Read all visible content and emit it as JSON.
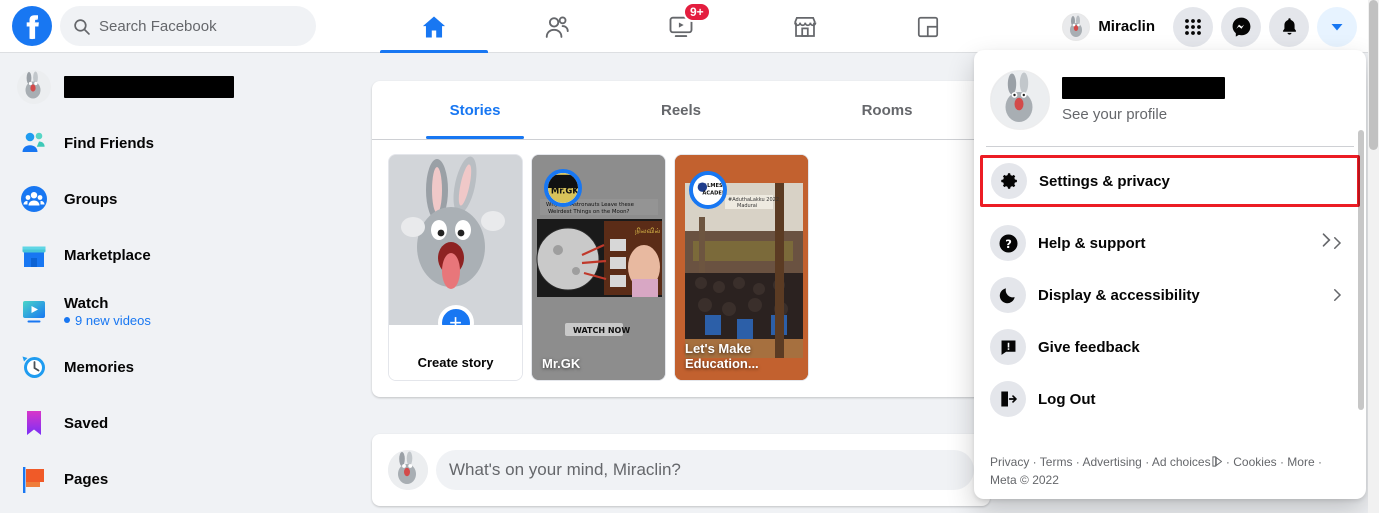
{
  "brand": {
    "accent": "#1877f2",
    "bg": "#f0f2f5",
    "badge_red": "#e41e3f",
    "highlight_red": "#ec1c24"
  },
  "topbar": {
    "logo": "facebook-logo",
    "search": {
      "placeholder": "Search Facebook",
      "value": "",
      "icon": "search-icon"
    },
    "nav": [
      {
        "name": "home",
        "icon": "home-icon",
        "selected": true,
        "badge": ""
      },
      {
        "name": "friends",
        "icon": "friends-icon",
        "selected": false,
        "badge": ""
      },
      {
        "name": "watch",
        "icon": "watch-icon",
        "selected": false,
        "badge": "9+"
      },
      {
        "name": "marketplace",
        "icon": "marketplace-icon",
        "selected": false,
        "badge": ""
      },
      {
        "name": "groups",
        "icon": "gaming-icon",
        "selected": false,
        "badge": ""
      }
    ],
    "profile_name": "Miraclin",
    "actions": [
      {
        "name": "menu",
        "icon": "grid-menu-icon"
      },
      {
        "name": "messenger",
        "icon": "messenger-icon"
      },
      {
        "name": "notifications",
        "icon": "bell-icon"
      },
      {
        "name": "account",
        "icon": "chevron-down-icon",
        "active": true
      }
    ]
  },
  "sidebar": {
    "items": [
      {
        "label": "",
        "redacted": true,
        "icon": "profile-avatar-icon"
      },
      {
        "label": "Find Friends",
        "icon": "find-friends-icon"
      },
      {
        "label": "Groups",
        "icon": "groups-icon"
      },
      {
        "label": "Marketplace",
        "icon": "marketplace-icon"
      },
      {
        "label": "Watch",
        "icon": "watch-icon",
        "sub": "9 new videos"
      },
      {
        "label": "Memories",
        "icon": "memories-icon"
      },
      {
        "label": "Saved",
        "icon": "saved-icon"
      },
      {
        "label": "Pages",
        "icon": "pages-icon"
      }
    ]
  },
  "feed": {
    "tabs": [
      {
        "label": "Stories",
        "selected": true
      },
      {
        "label": "Reels",
        "selected": false
      },
      {
        "label": "Rooms",
        "selected": false
      }
    ],
    "stories": [
      {
        "type": "create",
        "label": "Create story",
        "plus": "+"
      },
      {
        "type": "story",
        "name": "Mr.GK",
        "ring_label": "Mr.GK",
        "overlay_text": "WATCH NOW"
      },
      {
        "type": "story",
        "name": "Let's Make Education...",
        "ring_label": "LMES ACADEMY",
        "overlay_text": ""
      }
    ],
    "composer": {
      "placeholder": "What's on your mind, Miraclin?"
    }
  },
  "dropdown": {
    "profile": {
      "name_redacted": true,
      "subtitle": "See your profile",
      "avatar": "profile-avatar-icon"
    },
    "items": [
      {
        "label": "Settings & privacy",
        "icon": "gear-icon",
        "chevron": true,
        "highlighted": true
      },
      {
        "label": "Help & support",
        "icon": "question-mark-icon",
        "chevron": true,
        "highlighted": false
      },
      {
        "label": "Display & accessibility",
        "icon": "moon-icon",
        "chevron": true,
        "highlighted": false
      },
      {
        "label": "Give feedback",
        "icon": "feedback-icon",
        "chevron": false,
        "highlighted": false
      },
      {
        "label": "Log Out",
        "icon": "logout-icon",
        "chevron": false,
        "highlighted": false
      }
    ],
    "footer": {
      "links": [
        "Privacy",
        "Terms",
        "Advertising",
        "Ad choices",
        "Cookies",
        "More"
      ],
      "copyright": "Meta © 2022",
      "adchoices_icon": "adchoices-icon",
      "separator": " · "
    }
  }
}
